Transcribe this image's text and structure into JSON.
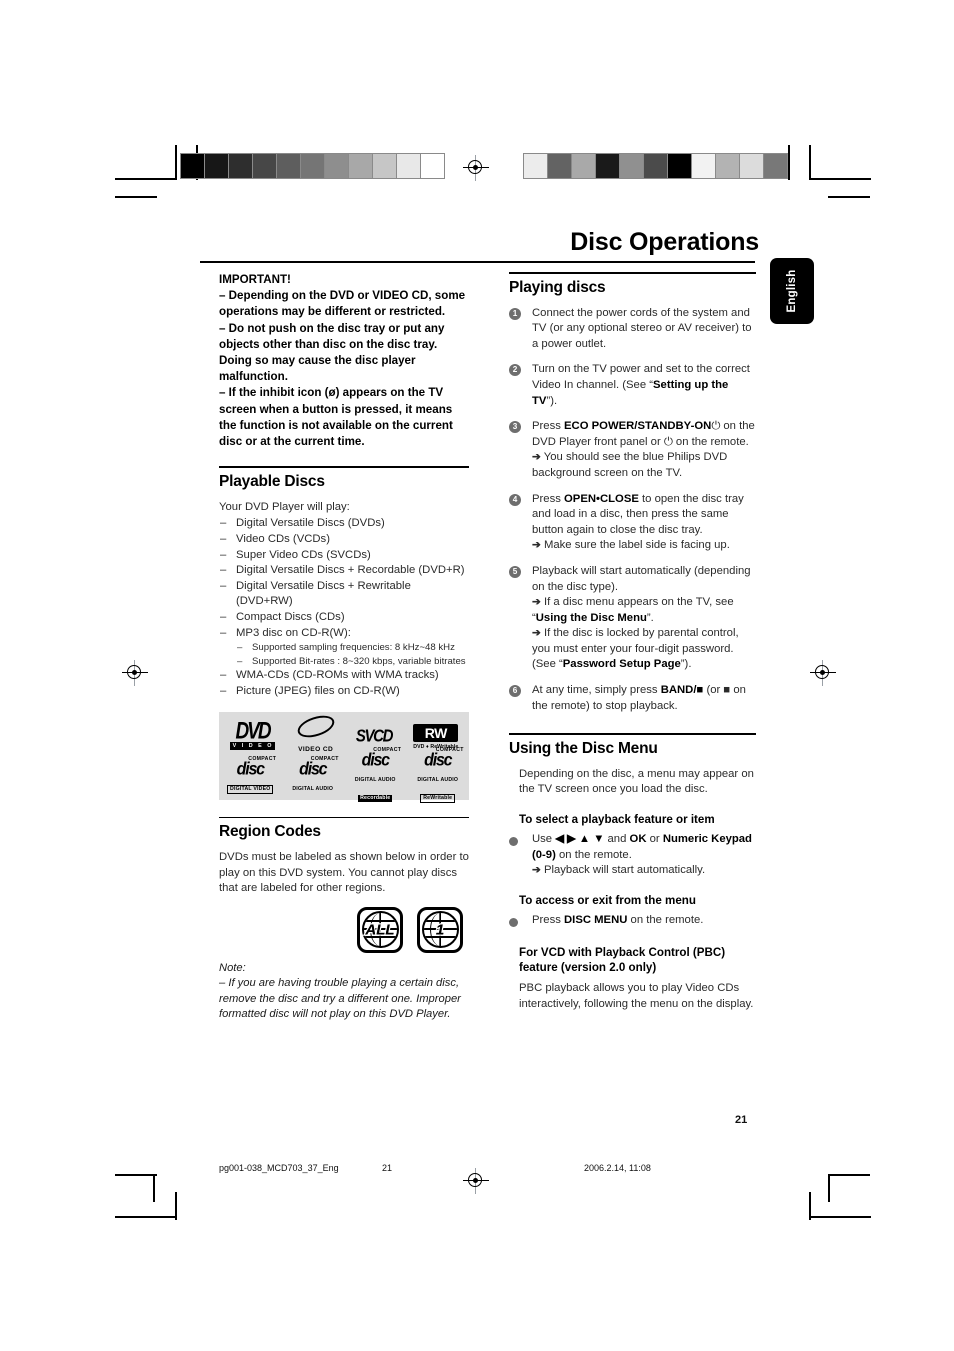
{
  "page": {
    "title": "Disc Operations",
    "language_tab": "English",
    "page_number": "21"
  },
  "footer": {
    "filename": "pg001-038_MCD703_37_Eng",
    "page": "21",
    "timestamp": "2006.2.14, 11:08"
  },
  "left_column": {
    "important": {
      "heading": "IMPORTANT!",
      "items": [
        "–  Depending on the DVD or VIDEO CD, some operations may be different or restricted.",
        "–  Do not push on the disc tray or put any objects other than disc on the disc tray. Doing so may cause the disc player malfunction.",
        "–  If the inhibit icon (ø) appears on the TV screen when a button is pressed, it means the function is not available on the current disc or at the current time."
      ]
    },
    "playable_discs": {
      "heading": "Playable Discs",
      "intro": "Your DVD Player will play:",
      "items": [
        "Digital Versatile Discs (DVDs)",
        "Video CDs (VCDs)",
        "Super Video CDs (SVCDs)",
        "Digital Versatile Discs + Recordable (DVD+R)",
        "Digital Versatile Discs + Rewritable (DVD+RW)",
        "Compact Discs (CDs)",
        "MP3 disc on CD-R(W):",
        "WMA-CDs (CD-ROMs with  WMA tracks)",
        "Picture (JPEG) files on CD-R(W)"
      ],
      "mp3_sub_items": [
        "Supported sampling frequencies: 8 kHz~48 kHz",
        "Supported Bit-rates : 8~320 kbps, variable bitrates"
      ]
    },
    "logos": {
      "row1": [
        {
          "name": "dvd-video-logo",
          "main": "DVD",
          "sub": "V I D E O"
        },
        {
          "name": "video-cd-logo",
          "main": "",
          "sub": "VIDEO CD"
        },
        {
          "name": "svcd-logo",
          "main": "SVCD",
          "sub": ""
        },
        {
          "name": "dvd-rewritable-logo",
          "main": "RW",
          "sub": "DVD ♦ ReWritable"
        }
      ],
      "row2": [
        {
          "name": "compact-disc-digital-video-logo",
          "top": "COMPACT",
          "mid": "disc",
          "bot": "DIGITAL VIDEO"
        },
        {
          "name": "compact-disc-digital-audio-logo",
          "top": "COMPACT",
          "mid": "disc",
          "bot": "DIGITAL AUDIO"
        },
        {
          "name": "compact-disc-recordable-logo",
          "top": "COMPACT",
          "mid": "disc",
          "bot": "DIGITAL AUDIO",
          "bot2": "Recordable"
        },
        {
          "name": "compact-disc-rewritable-logo",
          "top": "COMPACT",
          "mid": "disc",
          "bot": "DIGITAL AUDIO",
          "bot2": "ReWritable"
        }
      ]
    },
    "region_codes": {
      "heading": "Region Codes",
      "body": "DVDs must be labeled as shown below in order to play on this DVD system. You cannot play discs that are labeled for other regions.",
      "icons": [
        {
          "name": "region-all-icon",
          "label": "ALL"
        },
        {
          "name": "region-1-icon",
          "label": "1"
        }
      ],
      "note_label": "Note:",
      "note_body": "–  If you are having trouble playing a certain disc, remove the disc and try a different one. Improper formatted disc will not play on this DVD Player."
    }
  },
  "right_column": {
    "playing_discs": {
      "heading": "Playing discs",
      "steps": [
        {
          "num": "1",
          "text": "Connect the power cords of the system and TV (or any optional stereo or AV receiver) to a power outlet.",
          "arrows": []
        },
        {
          "num": "2",
          "text_pre": "Turn on the TV power and set to the correct Video In channel. (See “",
          "bold": "Setting up the TV",
          "text_post": "”).",
          "arrows": []
        },
        {
          "num": "3",
          "text_pre": "Press ",
          "bold": "ECO POWER/STANDBY-ON",
          "text_post": "⏻ on the DVD Player front panel or ⏻ on the remote.",
          "arrows": [
            "You should see the blue Philips DVD background screen on the TV."
          ]
        },
        {
          "num": "4",
          "text_pre": "Press ",
          "bold": "OPEN•CLOSE",
          "text_post": " to open the disc tray and load in a disc, then press the same button again to close the disc tray.",
          "arrows": [
            "Make sure the label side is facing up."
          ]
        },
        {
          "num": "5",
          "text": "Playback will start automatically (depending on the disc type).",
          "arrows": [
            "If a disc menu appears on the TV, see “Using the Disc Menu”.",
            "If the disc is locked by parental control, you must enter your four-digit password. (See “Password Setup Page”)."
          ],
          "arrow_bold_1": "Using the Disc Menu",
          "arrow_bold_2": "Password Setup Page"
        },
        {
          "num": "6",
          "text_pre": "At any time, simply press ",
          "bold": "BAND/■",
          "text_post": " (or ■  on the remote) to stop playback.",
          "arrows": []
        }
      ]
    },
    "disc_menu": {
      "heading": "Using the Disc Menu",
      "intro": "Depending on the disc, a menu may appear on the TV screen once you load the disc.",
      "sub1_heading": "To select a playback feature or item",
      "sub1_pre": "Use ",
      "sub1_keys": "◀ ▶ ▲ ▼",
      "sub1_mid": " and ",
      "sub1_bold1": "OK",
      "sub1_or": " or ",
      "sub1_bold2": "Numeric Keypad (0-9)",
      "sub1_post": " on the remote.",
      "sub1_arrow": "Playback will start automatically.",
      "sub2_heading": "To access or exit from the menu",
      "sub2_pre": "Press ",
      "sub2_bold": "DISC MENU",
      "sub2_post": " on the remote.",
      "sub3_heading": "For VCD with Playback Control (PBC) feature (version 2.0 only)",
      "sub3_body": "PBC playback allows you to play Video CDs interactively, following the menu on the display."
    }
  },
  "print_marks": {
    "gray_strip_left": [
      "#000000",
      "#171717",
      "#2e2e2e",
      "#474747",
      "#5e5e5e",
      "#757575",
      "#8e8e8e",
      "#a8a8a8",
      "#c6c6c6",
      "#e8e8e8",
      "#ffffff"
    ],
    "gray_strip_right": [
      "#ececec",
      "#636363",
      "#a9a9a9",
      "#1a1a1a",
      "#909090",
      "#4b4b4b",
      "#000000",
      "#f2f2f2",
      "#b3b3b3",
      "#dcdcdc",
      "#787878"
    ]
  }
}
